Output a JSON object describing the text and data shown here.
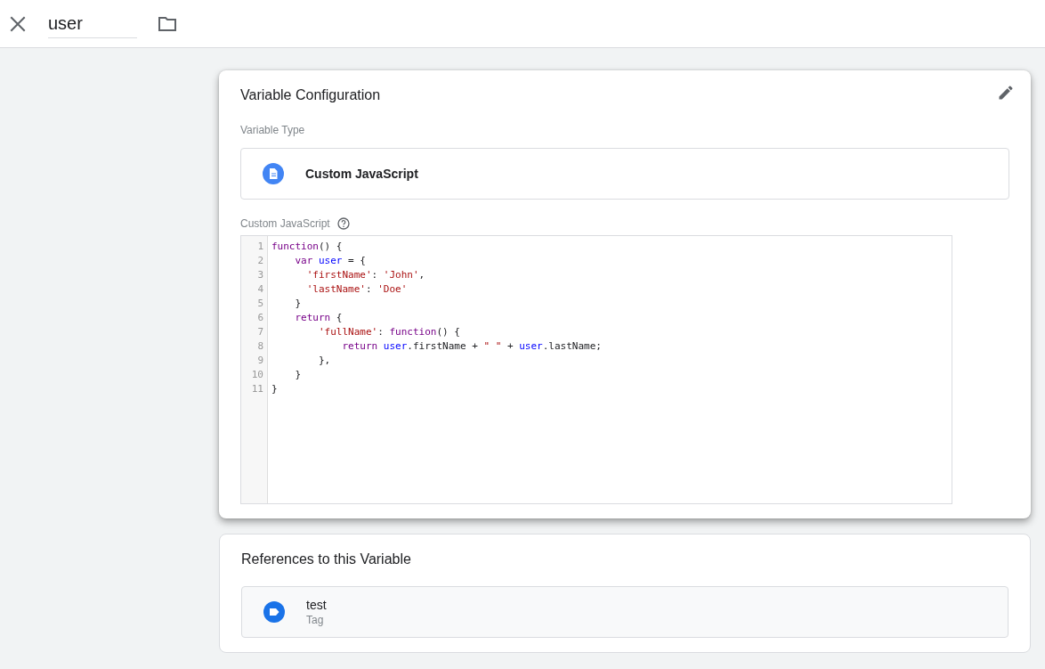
{
  "header": {
    "name_field": {
      "value": "user"
    }
  },
  "config_card": {
    "title": "Variable Configuration",
    "type_label": "Variable Type",
    "type_value": "Custom JavaScript",
    "code_label": "Custom JavaScript",
    "code_lines": [
      {
        "number": "1",
        "tokens": [
          {
            "kind": "keyword",
            "text": "function"
          },
          {
            "kind": "plain",
            "text": "() {"
          }
        ]
      },
      {
        "number": "2",
        "tokens": [
          {
            "kind": "keyword",
            "text": "    var"
          },
          {
            "kind": "variable",
            "text": " user"
          },
          {
            "kind": "plain",
            "text": " = {"
          }
        ]
      },
      {
        "number": "3",
        "tokens": [
          {
            "kind": "string",
            "text": "      'firstName'"
          },
          {
            "kind": "plain",
            "text": ": "
          },
          {
            "kind": "string",
            "text": "'John'"
          },
          {
            "kind": "plain",
            "text": ","
          }
        ]
      },
      {
        "number": "4",
        "tokens": [
          {
            "kind": "string",
            "text": "      'lastName'"
          },
          {
            "kind": "plain",
            "text": ": "
          },
          {
            "kind": "string",
            "text": "'Doe'"
          }
        ]
      },
      {
        "number": "5",
        "tokens": [
          {
            "kind": "plain",
            "text": "    }"
          }
        ]
      },
      {
        "number": "6",
        "tokens": [
          {
            "kind": "keyword",
            "text": "    return"
          },
          {
            "kind": "plain",
            "text": " {"
          }
        ]
      },
      {
        "number": "7",
        "tokens": [
          {
            "kind": "string",
            "text": "        'fullName'"
          },
          {
            "kind": "plain",
            "text": ": "
          },
          {
            "kind": "keyword",
            "text": "function"
          },
          {
            "kind": "plain",
            "text": "() {"
          }
        ]
      },
      {
        "number": "8",
        "tokens": [
          {
            "kind": "keyword",
            "text": "            return"
          },
          {
            "kind": "variable",
            "text": " user"
          },
          {
            "kind": "plain",
            "text": ".firstName + "
          },
          {
            "kind": "string",
            "text": "\" \""
          },
          {
            "kind": "plain",
            "text": " + "
          },
          {
            "kind": "variable",
            "text": "user"
          },
          {
            "kind": "plain",
            "text": ".lastName;"
          }
        ]
      },
      {
        "number": "9",
        "tokens": [
          {
            "kind": "plain",
            "text": "        },"
          }
        ]
      },
      {
        "number": "10",
        "tokens": [
          {
            "kind": "plain",
            "text": "    }"
          }
        ]
      },
      {
        "number": "11",
        "tokens": [
          {
            "kind": "plain",
            "text": "}"
          }
        ]
      }
    ]
  },
  "references_card": {
    "title": "References to this Variable",
    "items": [
      {
        "name": "test",
        "type": "Tag"
      }
    ]
  }
}
